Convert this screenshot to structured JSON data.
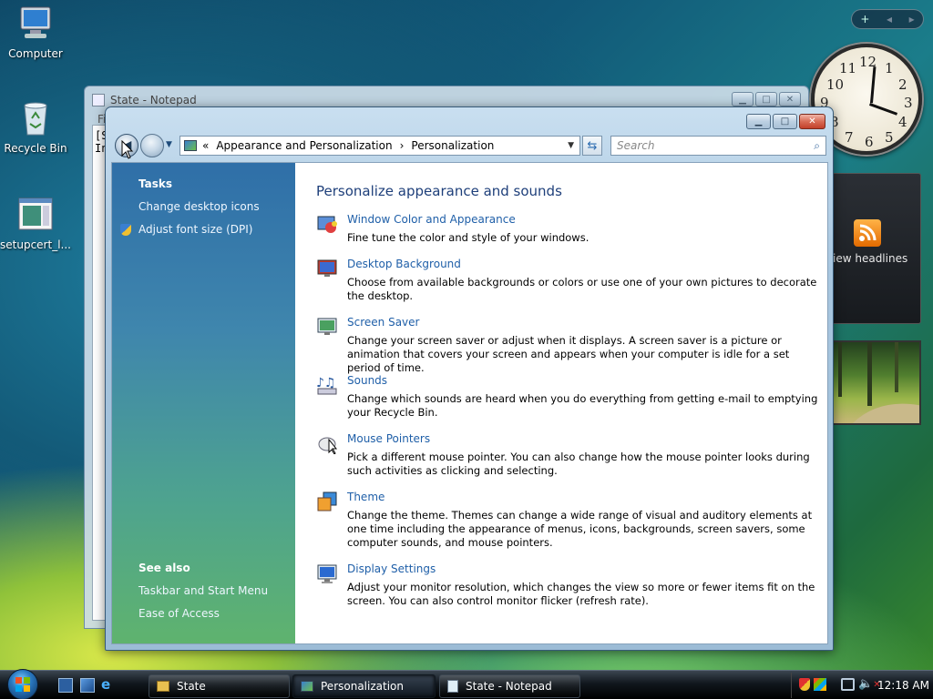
{
  "desktop": {
    "icons": [
      {
        "label": "Computer"
      },
      {
        "label": "Recycle Bin"
      },
      {
        "label": "setupcert_l..."
      }
    ]
  },
  "gadgets": {
    "feed_label": "iew headlines",
    "clock_numbers": [
      "12",
      "1",
      "2",
      "3",
      "4",
      "5",
      "6",
      "7",
      "8",
      "9",
      "10",
      "11"
    ]
  },
  "notepad": {
    "title": "State - Notepad",
    "menu_first": "Fi",
    "text_line1": "[S",
    "text_line2": "In"
  },
  "window": {
    "address": {
      "prefix": "«",
      "crumb1": "Appearance and Personalization",
      "sep": "›",
      "crumb2": "Personalization"
    },
    "search_placeholder": "Search",
    "tasks_header": "Tasks",
    "tasks": [
      "Change desktop icons",
      "Adjust font size (DPI)"
    ],
    "seealso_header": "See also",
    "seealso": [
      "Taskbar and Start Menu",
      "Ease of Access"
    ],
    "page_title": "Personalize appearance and sounds",
    "items": [
      {
        "label": "Window Color and Appearance",
        "desc": "Fine tune the color and style of your windows.",
        "icon": "window-color-icon"
      },
      {
        "label": "Desktop Background",
        "desc": "Choose from available backgrounds or colors or use one of your own pictures to decorate the desktop.",
        "icon": "desktop-background-icon"
      },
      {
        "label": "Screen Saver",
        "desc": "Change your screen saver or adjust when it displays. A screen saver is a picture or animation that covers your screen and appears when your computer is idle for a set period of time.",
        "icon": "screen-saver-icon"
      },
      {
        "label": "Sounds",
        "desc": "Change which sounds are heard when you do everything from getting e-mail to emptying your Recycle Bin.",
        "icon": "sounds-icon"
      },
      {
        "label": "Mouse Pointers",
        "desc": "Pick a different mouse pointer. You can also change how the mouse pointer looks during such activities as clicking and selecting.",
        "icon": "mouse-icon"
      },
      {
        "label": "Theme",
        "desc": "Change the theme. Themes can change a wide range of visual and auditory elements at one time including the appearance of menus, icons, backgrounds, screen savers, some computer sounds, and mouse pointers.",
        "icon": "theme-icon"
      },
      {
        "label": "Display Settings",
        "desc": "Adjust your monitor resolution, which changes the view so more or fewer items fit on the screen. You can also control monitor flicker (refresh rate).",
        "icon": "display-icon"
      }
    ]
  },
  "taskbar": {
    "buttons": [
      {
        "label": "State"
      },
      {
        "label": "Personalization"
      },
      {
        "label": "State - Notepad"
      }
    ],
    "clock": "12:18 AM"
  }
}
